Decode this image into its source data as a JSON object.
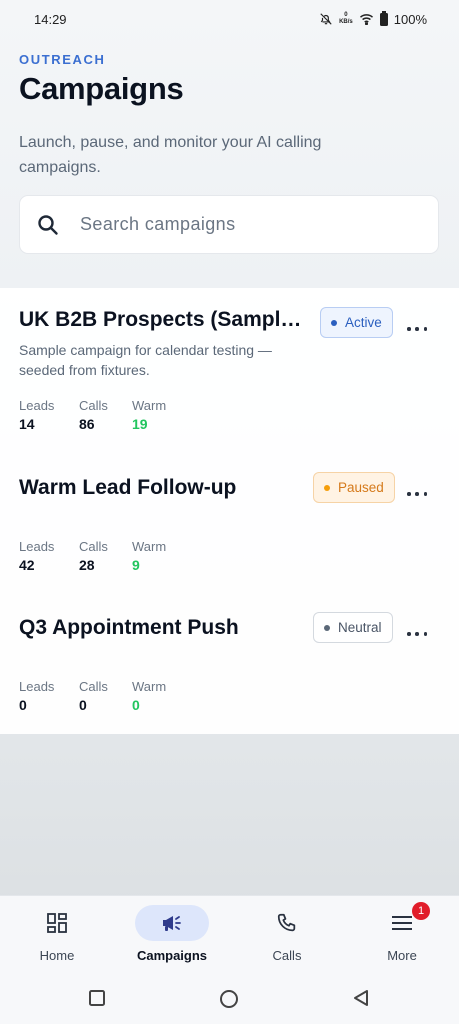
{
  "status_bar": {
    "time": "14:29",
    "net_speed_value": "0",
    "net_speed_unit": "KB/s",
    "battery": "100%"
  },
  "header": {
    "eyebrow": "OUTREACH",
    "title": "Campaigns"
  },
  "subtitle": "Launch, pause, and monitor your AI calling campaigns.",
  "search": {
    "placeholder": "Search campaigns"
  },
  "campaigns": [
    {
      "title": "UK B2B Prospects (Sample ...",
      "description": "Sample campaign for calendar testing — seeded from fixtures.",
      "status": "Active",
      "leads_label": "Leads",
      "leads": "14",
      "calls_label": "Calls",
      "calls": "86",
      "warm_label": "Warm",
      "warm": "19"
    },
    {
      "title": "Warm Lead Follow-up",
      "description": "",
      "status": "Paused",
      "leads_label": "Leads",
      "leads": "42",
      "calls_label": "Calls",
      "calls": "28",
      "warm_label": "Warm",
      "warm": "9"
    },
    {
      "title": "Q3 Appointment Push",
      "description": "",
      "status": "Neutral",
      "leads_label": "Leads",
      "leads": "0",
      "calls_label": "Calls",
      "calls": "0",
      "warm_label": "Warm",
      "warm": "0"
    }
  ],
  "bottom_nav": {
    "items": [
      {
        "label": "Home",
        "icon": "grid-icon"
      },
      {
        "label": "Campaigns",
        "icon": "megaphone-icon",
        "active": true
      },
      {
        "label": "Calls",
        "icon": "phone-icon"
      },
      {
        "label": "More",
        "icon": "menu-icon",
        "badge": "1"
      }
    ]
  },
  "colors": {
    "accent": "#3b6fd1",
    "warm": "#22c55e",
    "active_badge": "#2b5fbf",
    "paused_badge": "#d57a1b",
    "nav_active_pill": "#dde6fb",
    "notification": "#e11d2a"
  }
}
